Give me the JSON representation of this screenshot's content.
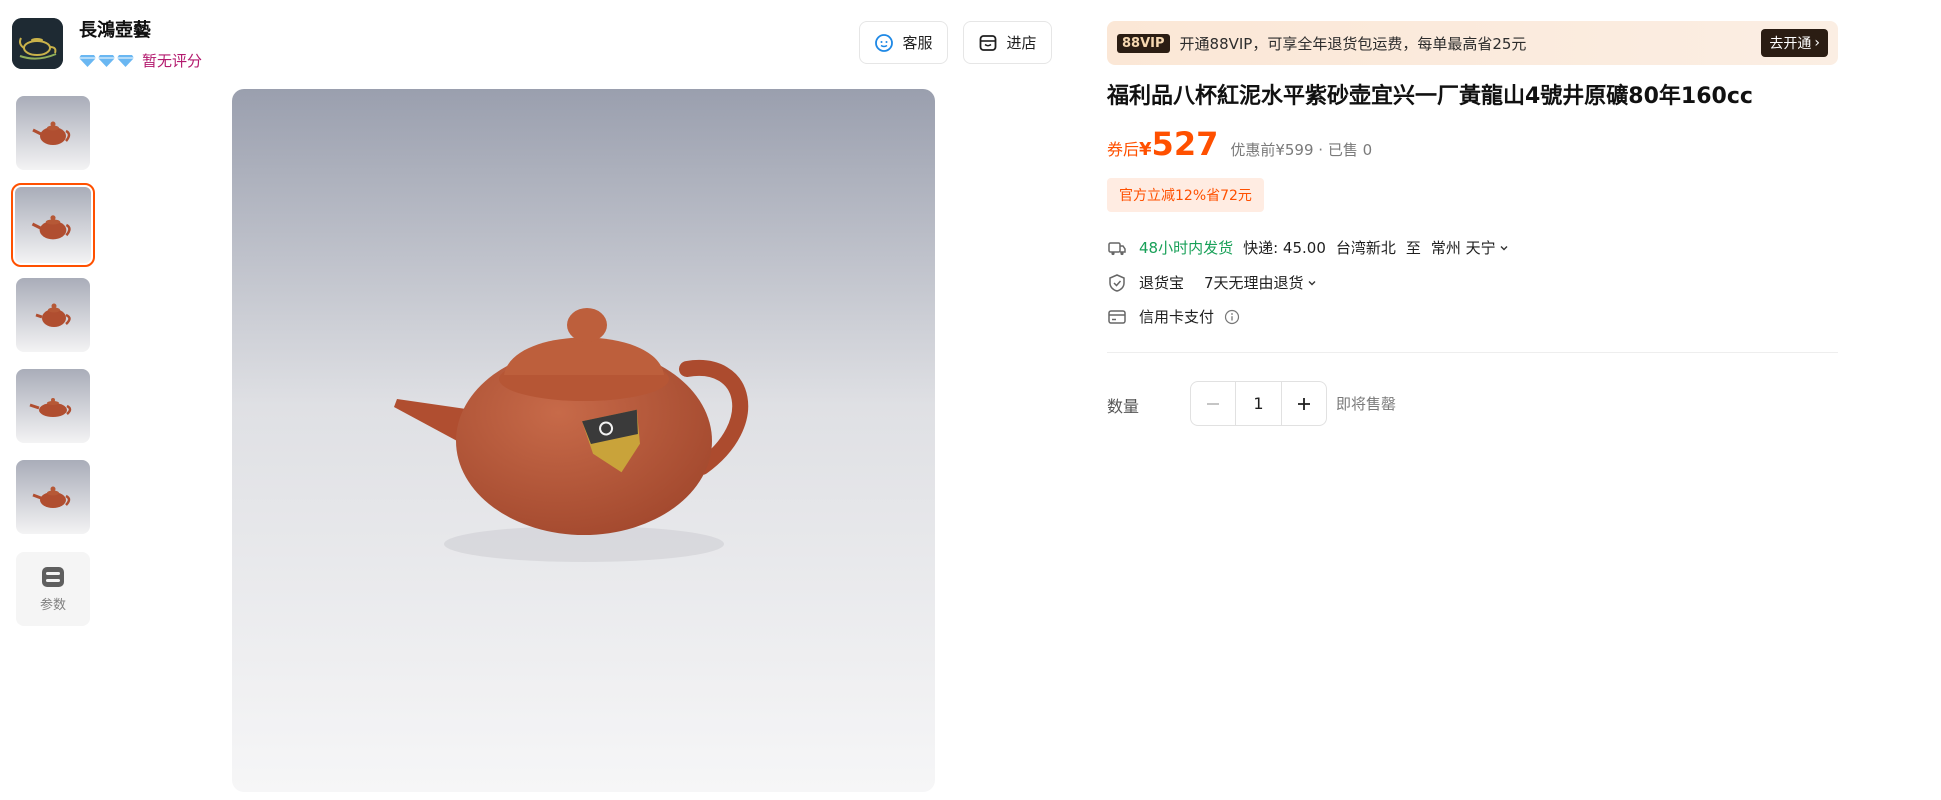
{
  "shop": {
    "name": "長鴻壺藝",
    "rating_text": "暂无评分",
    "buttons": {
      "service": "客服",
      "store": "进店"
    }
  },
  "gallery": {
    "thumbnail_count": 5,
    "active_index": 1,
    "params_label": "参数"
  },
  "vip": {
    "badge": "88VIP",
    "text": "开通88VIP，可享全年退货包运费，每单最高省25元",
    "button": "去开通"
  },
  "product": {
    "title": "福利品八杯紅泥水平紫砂壶宜兴一厂黃龍山4號井原礦80年160cc",
    "price_prefix": "券后",
    "currency": "¥",
    "price": "527",
    "price_meta": "优惠前¥599 · 已售 0",
    "promo_tag": "官方立减12%省72元"
  },
  "shipping": {
    "dispatch": "48小时内发货",
    "express": "快递: 45.00",
    "from": "台湾新北",
    "to_word": "至",
    "to": "常州 天宁"
  },
  "returns": {
    "label": "退货宝",
    "policy": "7天无理由退货"
  },
  "payment": {
    "label": "信用卡支付"
  },
  "quantity": {
    "label": "数量",
    "value": "1",
    "status": "即将售罄"
  },
  "colors": {
    "accent": "#ff5000",
    "green": "#18a058",
    "rating": "#b3186d"
  }
}
